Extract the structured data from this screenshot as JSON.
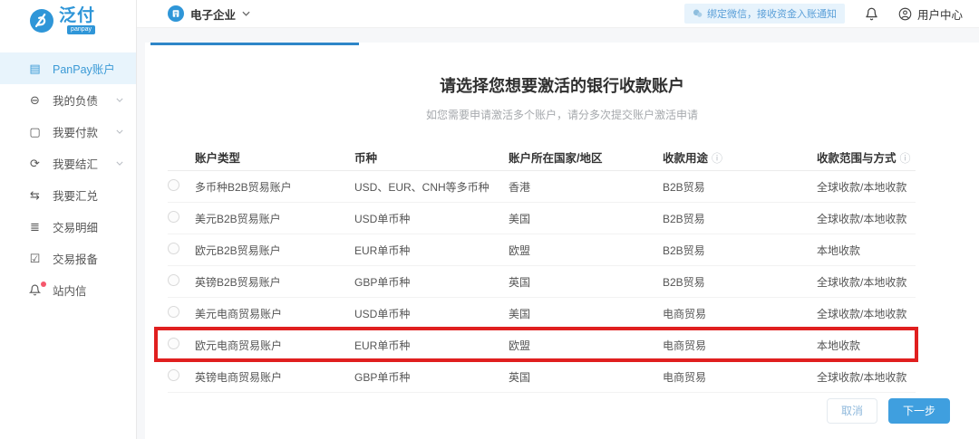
{
  "brand": {
    "name": "泛付",
    "sub": "panpay"
  },
  "topbar": {
    "company": "电子企业",
    "wechat_banner": "绑定微信，接收资金入账通知",
    "user_center": "用户中心"
  },
  "sidebar": {
    "items": [
      {
        "label": "PanPay账户",
        "icon": "card-icon",
        "active": true,
        "chevron": false,
        "dot": false
      },
      {
        "label": "我的负债",
        "icon": "minus-circle-icon",
        "active": false,
        "chevron": true,
        "dot": false
      },
      {
        "label": "我要付款",
        "icon": "wallet-icon",
        "active": false,
        "chevron": true,
        "dot": false
      },
      {
        "label": "我要结汇",
        "icon": "refresh-icon",
        "active": false,
        "chevron": true,
        "dot": false
      },
      {
        "label": "我要汇兑",
        "icon": "exchange-icon",
        "active": false,
        "chevron": false,
        "dot": false
      },
      {
        "label": "交易明细",
        "icon": "list-icon",
        "active": false,
        "chevron": false,
        "dot": false
      },
      {
        "label": "交易报备",
        "icon": "calendar-check-icon",
        "active": false,
        "chevron": false,
        "dot": false
      },
      {
        "label": "站内信",
        "icon": "bell-icon",
        "active": false,
        "chevron": false,
        "dot": true
      }
    ]
  },
  "main": {
    "title": "请选择您想要激活的银行收款账户",
    "subtitle": "如您需要申请激活多个账户，请分多次提交账户激活申请",
    "progress_percent": 25
  },
  "table": {
    "columns": [
      {
        "label": "账户类型",
        "info": false
      },
      {
        "label": "币种",
        "info": false
      },
      {
        "label": "账户所在国家/地区",
        "info": false
      },
      {
        "label": "收款用途",
        "info": true
      },
      {
        "label": "收款范围与方式",
        "info": true
      }
    ],
    "rows": [
      {
        "type": "多币种B2B贸易账户",
        "currency": "USD、EUR、CNH等多币种",
        "country": "香港",
        "purpose": "B2B贸易",
        "scope": "全球收款/本地收款",
        "highlighted": false
      },
      {
        "type": "美元B2B贸易账户",
        "currency": "USD单币种",
        "country": "美国",
        "purpose": "B2B贸易",
        "scope": "全球收款/本地收款",
        "highlighted": false
      },
      {
        "type": "欧元B2B贸易账户",
        "currency": "EUR单币种",
        "country": "欧盟",
        "purpose": "B2B贸易",
        "scope": "本地收款",
        "highlighted": false
      },
      {
        "type": "英镑B2B贸易账户",
        "currency": "GBP单币种",
        "country": "英国",
        "purpose": "B2B贸易",
        "scope": "全球收款/本地收款",
        "highlighted": false
      },
      {
        "type": "美元电商贸易账户",
        "currency": "USD单币种",
        "country": "美国",
        "purpose": "电商贸易",
        "scope": "全球收款/本地收款",
        "highlighted": false
      },
      {
        "type": "欧元电商贸易账户",
        "currency": "EUR单币种",
        "country": "欧盟",
        "purpose": "电商贸易",
        "scope": "本地收款",
        "highlighted": true
      },
      {
        "type": "英镑电商贸易账户",
        "currency": "GBP单币种",
        "country": "英国",
        "purpose": "电商贸易",
        "scope": "全球收款/本地收款",
        "highlighted": false
      }
    ]
  },
  "footer": {
    "cancel_label": "取消",
    "next_label": "下一步"
  },
  "colors": {
    "primary": "#2f96d8",
    "highlight_red": "#e01f1f",
    "active_item_bg": "#e8f4fc",
    "badge_bg": "#e7f3fc"
  }
}
